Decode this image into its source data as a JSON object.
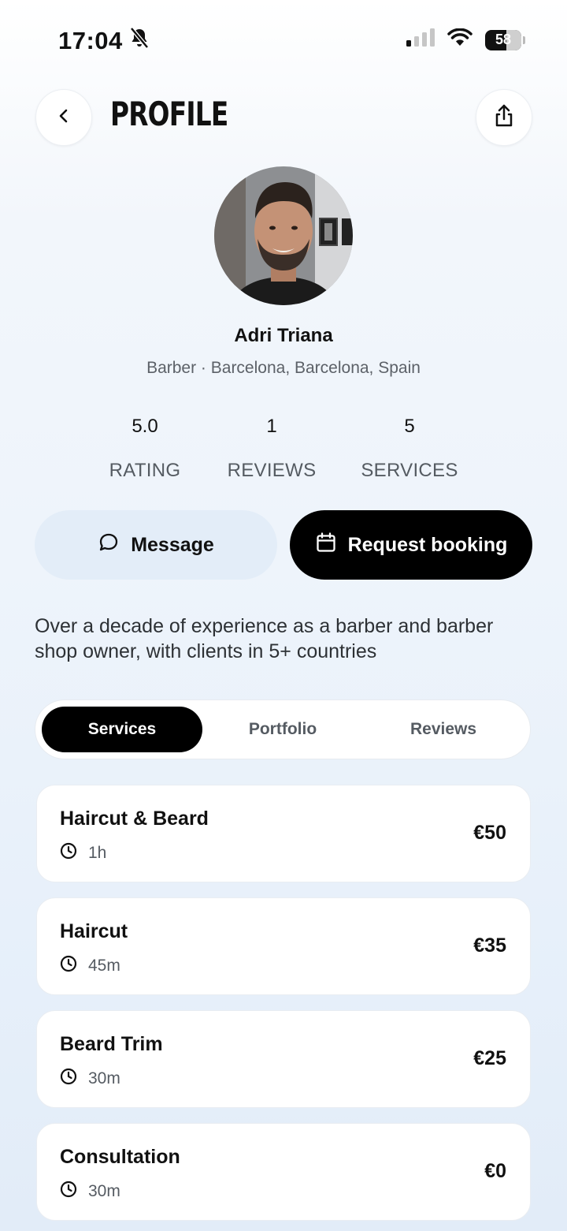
{
  "status_bar": {
    "time": "17:04",
    "battery": "58"
  },
  "header": {
    "title": "PROFILE"
  },
  "profile": {
    "name": "Adri Triana",
    "subtitle": "Barber · Barcelona, Barcelona, Spain",
    "stats": [
      {
        "value": "5.0",
        "label": "RATING"
      },
      {
        "value": "1",
        "label": "REVIEWS"
      },
      {
        "value": "5",
        "label": "SERVICES"
      }
    ],
    "bio": "Over a decade of experience as a barber and barber shop owner, with clients in 5+ countries"
  },
  "actions": {
    "message_label": "Message",
    "booking_label": "Request booking"
  },
  "tabs": [
    {
      "label": "Services",
      "active": true
    },
    {
      "label": "Portfolio",
      "active": false
    },
    {
      "label": "Reviews",
      "active": false
    }
  ],
  "services": [
    {
      "title": "Haircut & Beard",
      "duration": "1h",
      "price": "€50"
    },
    {
      "title": "Haircut",
      "duration": "45m",
      "price": "€35"
    },
    {
      "title": "Beard Trim",
      "duration": "30m",
      "price": "€25"
    },
    {
      "title": "Consultation",
      "duration": "30m",
      "price": "€0"
    }
  ]
}
